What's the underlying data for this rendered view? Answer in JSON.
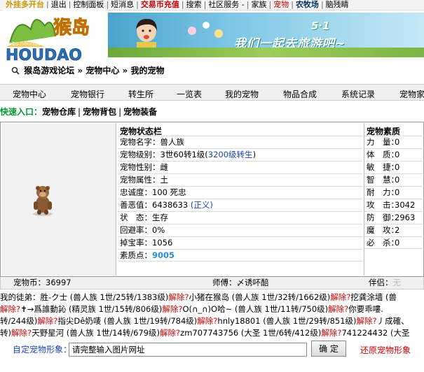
{
  "topnav": {
    "items": [
      "外挂多开台",
      "退出",
      "控制面板",
      "短消息",
      "交易币充值",
      "搜索",
      "社区服务 -",
      "家族",
      "宠物",
      "农牧场",
      "脑残睛"
    ]
  },
  "logo": {
    "text": "HOUDAO",
    "cn": "猴岛",
    "url": "bbs.houdao.com"
  },
  "banner": {
    "line1": "5·1",
    "line2": "我们一起去旅游吧~"
  },
  "breadcrumb": {
    "forum": "猴岛游戏论坛",
    "sep1": "»",
    "center": "宠物中心",
    "sep2": "»",
    "current": "我的宠物"
  },
  "tabs": [
    "宠物中心",
    "宠物银行",
    "转生所",
    "一览表",
    "我的宠物",
    "物品合成",
    "系统记录",
    "宠物家"
  ],
  "quick": {
    "label": "快速入口：",
    "links": [
      "宠物仓库",
      "宠物背包",
      "宠物装备"
    ]
  },
  "status": {
    "header": "宠物状态栏",
    "name_label": "宠物名字：",
    "name": "兽人族",
    "level_label": "宠物级别：",
    "level": "3世60转1级",
    "level_link": "3200级转生",
    "gender_label": "宠物性别：",
    "gender": "雌",
    "attr_label": "宠物属性：",
    "attr": "土",
    "loyalty_label": "忠诚度：",
    "loyalty": "100 死忠",
    "karma_label": "善恶值：",
    "karma": "6438633",
    "karma_tag": "(正义)",
    "state_label": "状　态：",
    "state": "生存",
    "recover_label": "回避率：",
    "recover": "0%",
    "drop_label": "掉宝率：",
    "drop": "1056",
    "points_label": "素质点：",
    "points": "9005"
  },
  "attrs": {
    "header": "宠物素质",
    "rows": [
      {
        "k": "力　量：",
        "v": "0"
      },
      {
        "k": "体　质：",
        "v": "0"
      },
      {
        "k": "敏　捷：",
        "v": "0"
      },
      {
        "k": "智　慧：",
        "v": "0"
      },
      {
        "k": "耐　力：",
        "v": "0"
      },
      {
        "k": "攻　击：",
        "v": "3042"
      },
      {
        "k": "防　御：",
        "v": "2963"
      },
      {
        "k": "魔　攻：",
        "v": "2"
      },
      {
        "k": "必　杀：",
        "v": "0"
      }
    ]
  },
  "footer": {
    "coins_label": "宠物币：",
    "coins": "36997",
    "master_label": "师傅：",
    "master": "〆诱吥醅",
    "partner_label": "伴侣：",
    "partner": "无"
  },
  "disciples": {
    "lines": [
      [
        {
          "t": "我的徒弟："
        },
        {
          "t": "胜-ク士 (兽人族 1世/25转/1383级)"
        },
        {
          "t": "解除?",
          "r": true
        },
        {
          "t": "小猪在猴岛 (兽人族 1世/32转/1662级)"
        },
        {
          "t": "解除?",
          "r": true
        },
        {
          "t": "挖龚涂墙 (兽"
        }
      ],
      [
        {
          "t": "解除?",
          "r": true
        },
        {
          "t": "✝→爲誰動訫 (精灵族 1世/15转/806级)"
        },
        {
          "t": "解除?",
          "r": true
        },
        {
          "t": "O(∩_∩)O哈~ (兽人族 1世/11转/750级)"
        },
        {
          "t": "解除?",
          "r": true
        },
        {
          "t": "你要乖嘍."
        }
      ],
      [
        {
          "t": "转/244级)"
        },
        {
          "t": "解除?",
          "r": true
        },
        {
          "t": "指尖Dê奶唛 (兽人族 1世/19转/784级)"
        },
        {
          "t": "解除?",
          "r": true
        },
        {
          "t": "hnly18801 (兽人族 1世/29转/851级)"
        },
        {
          "t": "解除?",
          "r": true
        },
        {
          "t": "丿成確、"
        }
      ],
      [
        {
          "t": "转)"
        },
        {
          "t": "解除?",
          "r": true
        },
        {
          "t": "天野星河 (兽人族 1世/14转/679级)"
        },
        {
          "t": "解除?",
          "r": true
        },
        {
          "t": "zm707743756 (大圣 1世/6转/412级)"
        },
        {
          "t": "解除?",
          "r": true
        },
        {
          "t": "741224432 (大圣"
        }
      ]
    ]
  },
  "custom": {
    "label": "自定宠物形象：",
    "placeholder": "请完整输入图片网址",
    "ok": "确 定",
    "restore": "还原宠物形象"
  }
}
